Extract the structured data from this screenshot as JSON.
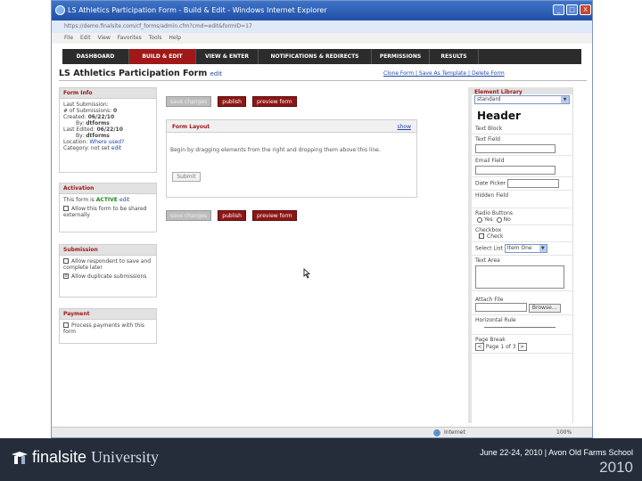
{
  "window": {
    "title": "LS Athletics Participation Form - Build & Edit - Windows Internet Explorer",
    "address": "https://demo.finalsite.com/cf_forms/admin.cfm?cmd=edit&formID=17",
    "min": "_",
    "max": "□",
    "close": "X",
    "menu": [
      "File",
      "Edit",
      "View",
      "Favorites",
      "Tools",
      "Help"
    ]
  },
  "nav": {
    "tabs": [
      {
        "label": "DASHBOARD",
        "active": false
      },
      {
        "label": "BUILD & EDIT",
        "active": true
      },
      {
        "label": "VIEW & ENTER",
        "active": false
      },
      {
        "label": "NOTIFICATIONS & REDIRECTS",
        "active": false
      },
      {
        "label": "PERMISSIONS",
        "active": false
      },
      {
        "label": "RESULTS",
        "active": false
      }
    ]
  },
  "page": {
    "title": "LS Athletics Participation Form",
    "edit": "edit",
    "clone_form": "Clone Form",
    "save_as_template": "Save As Template",
    "delete_form": "Delete Form",
    "sep": "|"
  },
  "form_info": {
    "header": "Form Info",
    "last_submission_label": "Last Submission:",
    "num_submissions_label": "# of Submissions:",
    "num_submissions": "0",
    "created_label": "Created:",
    "created": "06/22/10",
    "created_by_label": "By:",
    "created_by": "dtforms",
    "last_edited_label": "Last Edited:",
    "last_edited": "06/22/10",
    "edited_by_label": "By:",
    "edited_by": "dtforms",
    "location_label": "Location:",
    "location": "Where used?",
    "category_label": "Category:",
    "category": "not set",
    "category_edit": "edit"
  },
  "activation": {
    "header": "Activation",
    "text_pre": "This form is",
    "status": "ACTIVE",
    "edit": "edit",
    "allow_shared": "Allow this form to be shared externally"
  },
  "submission": {
    "header": "Submission",
    "allow_save": "Allow respondent to save and complete later",
    "allow_duplicate": "Allow duplicate submissions",
    "duplicate_mark": "x"
  },
  "payment": {
    "header": "Payment",
    "process_payments": "Process payments with this form"
  },
  "actions": {
    "save": "save changes",
    "publish": "publish",
    "preview": "preview form"
  },
  "layout": {
    "header": "Form Layout",
    "show": "show",
    "help": "Begin by dragging elements from the right and dropping them above this line.",
    "submit": "Submit"
  },
  "library": {
    "header": "Element Library",
    "selected": "standard",
    "arrow": "▼",
    "header_el": "Header",
    "text_block": "Text Block",
    "text_field": "Text Field",
    "email_field": "Email Field",
    "date_picker": "Date Picker",
    "hidden_field": "Hidden Field",
    "radio_buttons": "Radio Buttons",
    "yes": "Yes",
    "no": "No",
    "checkbox": "Checkbox",
    "check": "Check",
    "select_list": "Select List",
    "item_one": "Item One",
    "text_area": "Text Area",
    "attach_file": "Attach File",
    "browse": "Browse...",
    "horizontal_rule": "Horizontal Rule",
    "page_break": "Page Break",
    "prev": "<",
    "page_of": "Page 1 of 3",
    "next": ">"
  },
  "status": {
    "zone": "Internet",
    "zoom": "100%"
  },
  "footer": {
    "brand_a": "finalsite",
    "brand_b": "University",
    "event": "June 22-24, 2010 | Avon Old Farms School",
    "year": "2010"
  }
}
